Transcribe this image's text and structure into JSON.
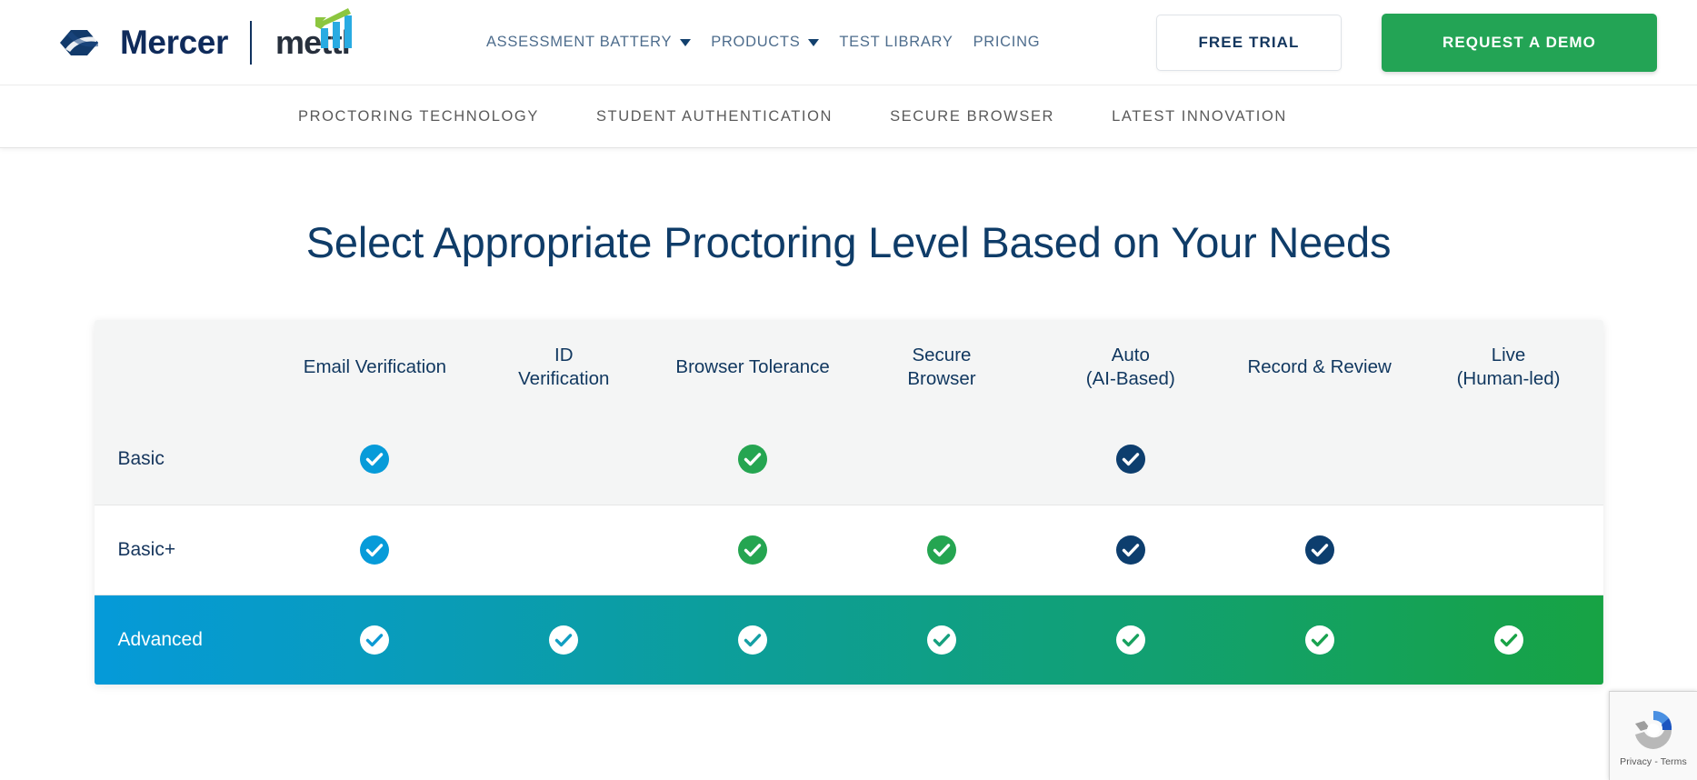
{
  "header": {
    "brand": {
      "mercer_text": "Mercer",
      "mettl_text": "mettl",
      "mercer_logo_icon": "mercer-infinity-mark",
      "mettl_bars_icon": "mettl-bar-chart-mark"
    },
    "nav": [
      {
        "label": "ASSESSMENT BATTERY",
        "has_caret": true
      },
      {
        "label": "PRODUCTS",
        "has_caret": true
      },
      {
        "label": "TEST LIBRARY",
        "has_caret": false
      },
      {
        "label": "PRICING",
        "has_caret": false
      }
    ],
    "free_trial_label": "FREE TRIAL",
    "request_demo_label": "REQUEST A DEMO",
    "demo_button_color": "#23a455"
  },
  "subnav": {
    "items": [
      {
        "label": "PROCTORING TECHNOLOGY"
      },
      {
        "label": "STUDENT AUTHENTICATION"
      },
      {
        "label": "SECURE BROWSER"
      },
      {
        "label": "LATEST INNOVATION"
      }
    ]
  },
  "main": {
    "section_title": "Select Appropriate Proctoring Level Based on Your Needs"
  },
  "table": {
    "columns": [
      {
        "label": ""
      },
      {
        "label": "Email Verification"
      },
      {
        "label": "ID\nVerification"
      },
      {
        "label": "Browser Tolerance"
      },
      {
        "label": "Secure\nBrowser"
      },
      {
        "label": "Auto\n(AI-Based)"
      },
      {
        "label": "Record & Review"
      },
      {
        "label": "Live\n(Human-led)"
      }
    ],
    "rows": [
      {
        "name": "Basic",
        "cells": [
          "lightblue",
          "none",
          "green",
          "none",
          "navy",
          "none",
          "none"
        ]
      },
      {
        "name": "Basic+",
        "cells": [
          "lightblue",
          "none",
          "green",
          "green",
          "navy",
          "navy",
          "none"
        ]
      },
      {
        "name": "Advanced",
        "cells": [
          "white",
          "white",
          "white",
          "white",
          "white",
          "white",
          "white"
        ]
      }
    ],
    "check_colors": {
      "lightblue": "#079bd9",
      "green": "#25a551",
      "navy": "#0d3e6e",
      "white": "#ffffff"
    },
    "advanced_gradient_start": "#059ad9",
    "advanced_gradient_end": "#17a344"
  },
  "recaptcha": {
    "icon": "recaptcha-logo-icon",
    "privacy_label": "Privacy",
    "separator": "-",
    "terms_label": "Terms"
  }
}
